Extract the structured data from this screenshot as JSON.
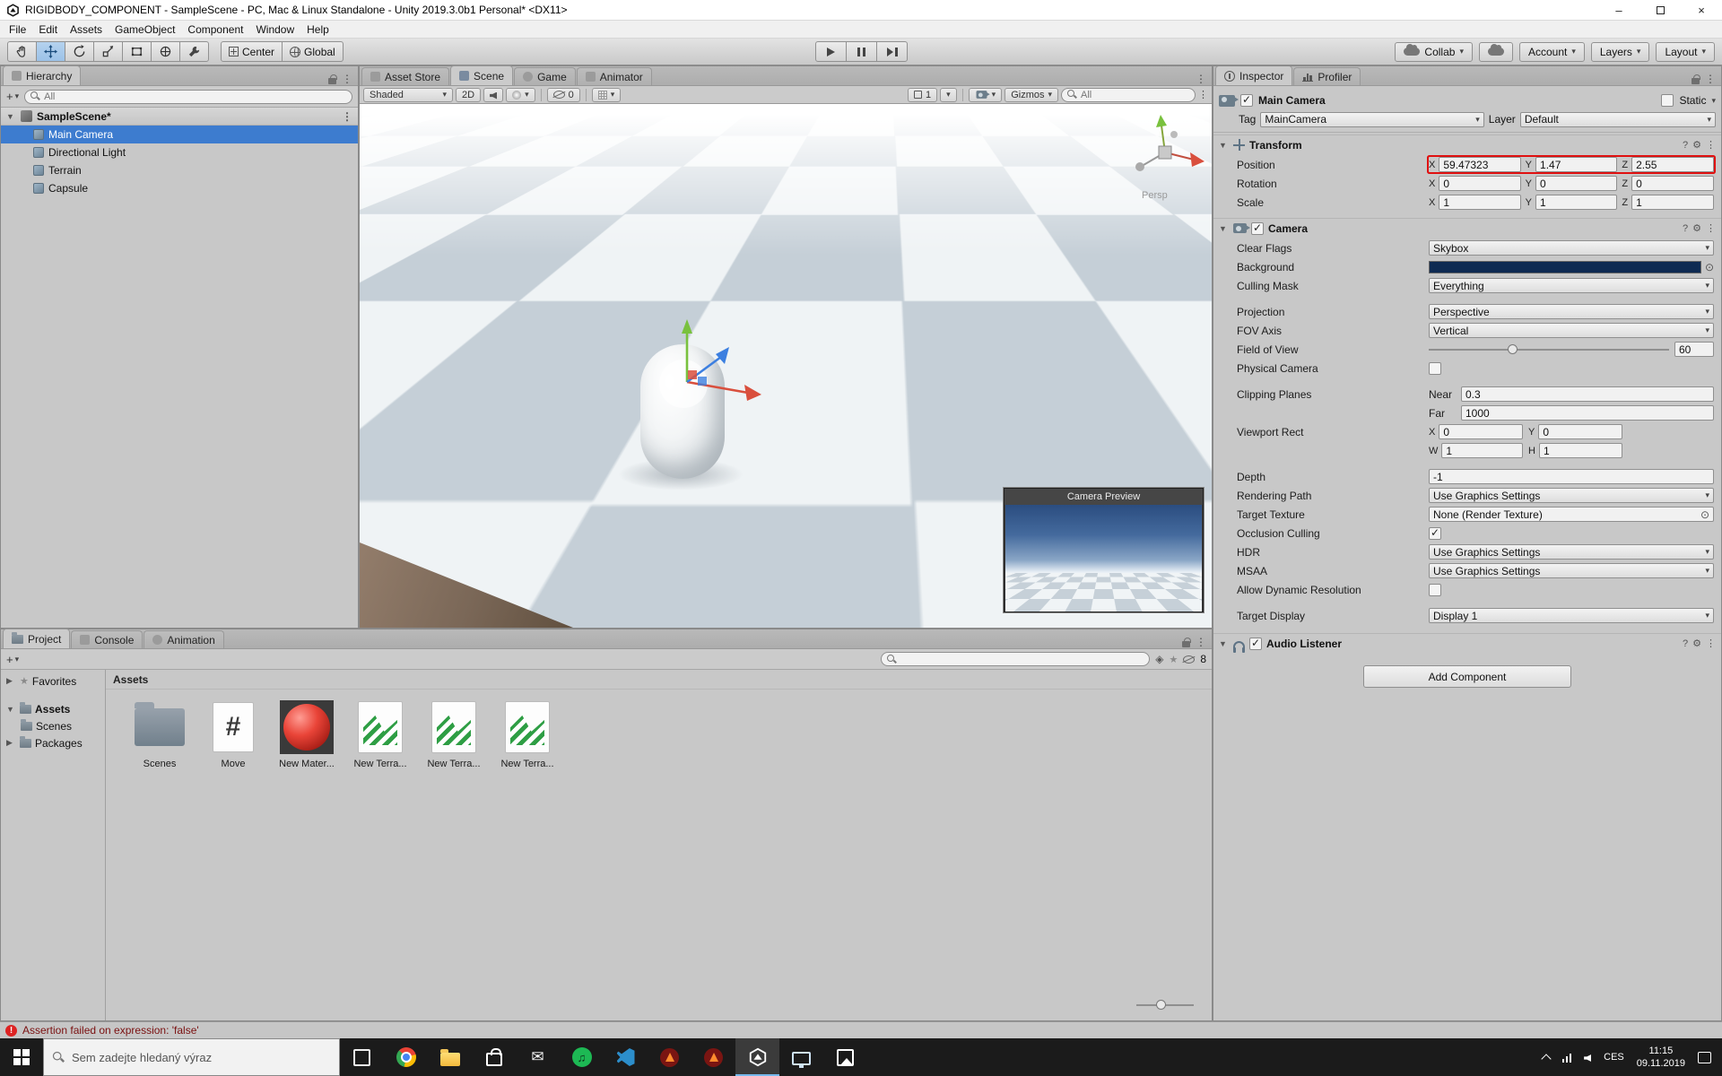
{
  "window": {
    "title": "RIGIDBODY_COMPONENT - SampleScene - PC, Mac & Linux Standalone - Unity 2019.3.0b1 Personal* <DX11>"
  },
  "menu": {
    "items": [
      "File",
      "Edit",
      "Assets",
      "GameObject",
      "Component",
      "Window",
      "Help"
    ]
  },
  "toolbar": {
    "center": "Center",
    "global": "Global",
    "collab": "Collab",
    "account": "Account",
    "layers": "Layers",
    "layout": "Layout"
  },
  "hierarchy": {
    "tab": "Hierarchy",
    "search_placeholder": "All",
    "scene_name": "SampleScene*",
    "items": [
      {
        "label": "Main Camera"
      },
      {
        "label": "Directional Light"
      },
      {
        "label": "Terrain"
      },
      {
        "label": "Capsule"
      }
    ]
  },
  "scene": {
    "tab_asset_store": "Asset Store",
    "tab_scene": "Scene",
    "tab_game": "Game",
    "tab_animator": "Animator",
    "shaded": "Shaded",
    "mode_2d": "2D",
    "hidden_count": "0",
    "grid_size": "1",
    "gizmos": "Gizmos",
    "search_placeholder": "All",
    "persp": "Persp",
    "camera_preview_title": "Camera Preview"
  },
  "inspector": {
    "tab_inspector": "Inspector",
    "tab_profiler": "Profiler",
    "object_name": "Main Camera",
    "static_label": "Static",
    "tag_label": "Tag",
    "tag_value": "MainCamera",
    "layer_label": "Layer",
    "layer_value": "Default",
    "transform": {
      "title": "Transform",
      "position_label": "Position",
      "rotation_label": "Rotation",
      "scale_label": "Scale",
      "px": "59.47323",
      "py": "1.47",
      "pz": "2.55",
      "rx": "0",
      "ry": "0",
      "rz": "0",
      "sx": "1",
      "sy": "1",
      "sz": "1"
    },
    "camera": {
      "title": "Camera",
      "clear_flags_label": "Clear Flags",
      "clear_flags_value": "Skybox",
      "background_label": "Background",
      "background_color": "#0e2a52",
      "culling_mask_label": "Culling Mask",
      "culling_mask_value": "Everything",
      "projection_label": "Projection",
      "projection_value": "Perspective",
      "fov_axis_label": "FOV Axis",
      "fov_axis_value": "Vertical",
      "fov_label": "Field of View",
      "fov_value": "60",
      "physical_label": "Physical Camera",
      "clipping_label": "Clipping Planes",
      "near_label": "Near",
      "near_value": "0.3",
      "far_label": "Far",
      "far_value": "1000",
      "viewport_label": "Viewport Rect",
      "vx": "0",
      "vy": "0",
      "vw": "1",
      "vh": "1",
      "depth_label": "Depth",
      "depth_value": "-1",
      "rendering_path_label": "Rendering Path",
      "rendering_path_value": "Use Graphics Settings",
      "target_texture_label": "Target Texture",
      "target_texture_value": "None (Render Texture)",
      "occlusion_label": "Occlusion Culling",
      "hdr_label": "HDR",
      "hdr_value": "Use Graphics Settings",
      "msaa_label": "MSAA",
      "msaa_value": "Use Graphics Settings",
      "dynamic_res_label": "Allow Dynamic Resolution",
      "target_display_label": "Target Display",
      "target_display_value": "Display 1"
    },
    "audio_listener_title": "Audio Listener",
    "add_component_label": "Add Component"
  },
  "axes": {
    "x": "X",
    "y": "Y",
    "z": "Z",
    "w": "W",
    "h": "H"
  },
  "project": {
    "tab_project": "Project",
    "tab_console": "Console",
    "tab_animation": "Animation",
    "favorites_label": "Favorites",
    "assets_label": "Assets",
    "scenes_label": "Scenes",
    "packages_label": "Packages",
    "breadcrumb": "Assets",
    "hidden_badge": "8",
    "items": [
      {
        "label": "Scenes"
      },
      {
        "label": "Move"
      },
      {
        "label": "New Mater..."
      },
      {
        "label": "New Terra..."
      },
      {
        "label": "New Terra..."
      },
      {
        "label": "New Terra..."
      }
    ]
  },
  "status": {
    "error": "Assertion failed on expression: 'false'"
  },
  "taskbar": {
    "search_placeholder": "Sem zadejte hledaný výraz",
    "time": "11:15",
    "date": "09.11.2019",
    "lang": "CES"
  },
  "icons": {
    "dropdown": "▾",
    "fold_open": "▼",
    "fold_closed": "▶",
    "menu": "⋮",
    "gear": "⚙",
    "help": "?",
    "plus": "+",
    "object_picker": "⊙",
    "star": "★"
  },
  "colors": {
    "selection": "#3d7ccf",
    "highlight_red": "#e01010",
    "background_swatch": "#0e2a52"
  }
}
